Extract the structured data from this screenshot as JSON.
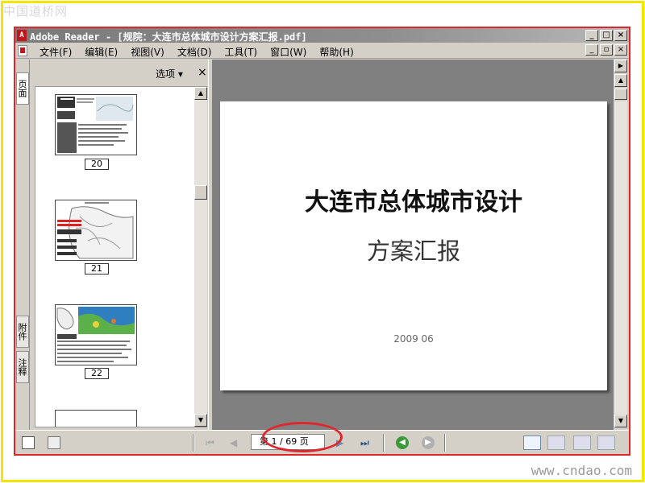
{
  "watermark": {
    "top": "中国道桥网",
    "bottom": "www.cndao.com"
  },
  "window": {
    "title": "Adobe Reader - [规院：大连市总体城市设计方案汇报.pdf]",
    "controls": [
      "_",
      "□",
      "×"
    ],
    "doc_controls": [
      "_",
      "▫",
      "×"
    ]
  },
  "menu": [
    {
      "label": "文件(F)"
    },
    {
      "label": "编辑(E)"
    },
    {
      "label": "视图(V)"
    },
    {
      "label": "文档(D)"
    },
    {
      "label": "工具(T)"
    },
    {
      "label": "窗口(W)"
    },
    {
      "label": "帮助(H)"
    }
  ],
  "side_tabs": {
    "pages": "页面",
    "attachments": "附件",
    "comments": "注释"
  },
  "panel": {
    "options_label": "选项 ▾",
    "close_label": "×",
    "thumbnails": [
      {
        "label": "20",
        "style": "slide-text"
      },
      {
        "label": "21",
        "style": "map-red"
      },
      {
        "label": "22",
        "style": "map-blue"
      }
    ]
  },
  "document": {
    "title": "大连市总体城市设计",
    "subtitle": "方案汇报",
    "date": "2009 06"
  },
  "statusbar": {
    "page_indicator": "第 1 / 69 页",
    "current_page": 1,
    "total_pages": 69
  },
  "colors": {
    "highlight": "#e0262d",
    "page_background": "#808080",
    "chrome": "#d4d0c8"
  }
}
